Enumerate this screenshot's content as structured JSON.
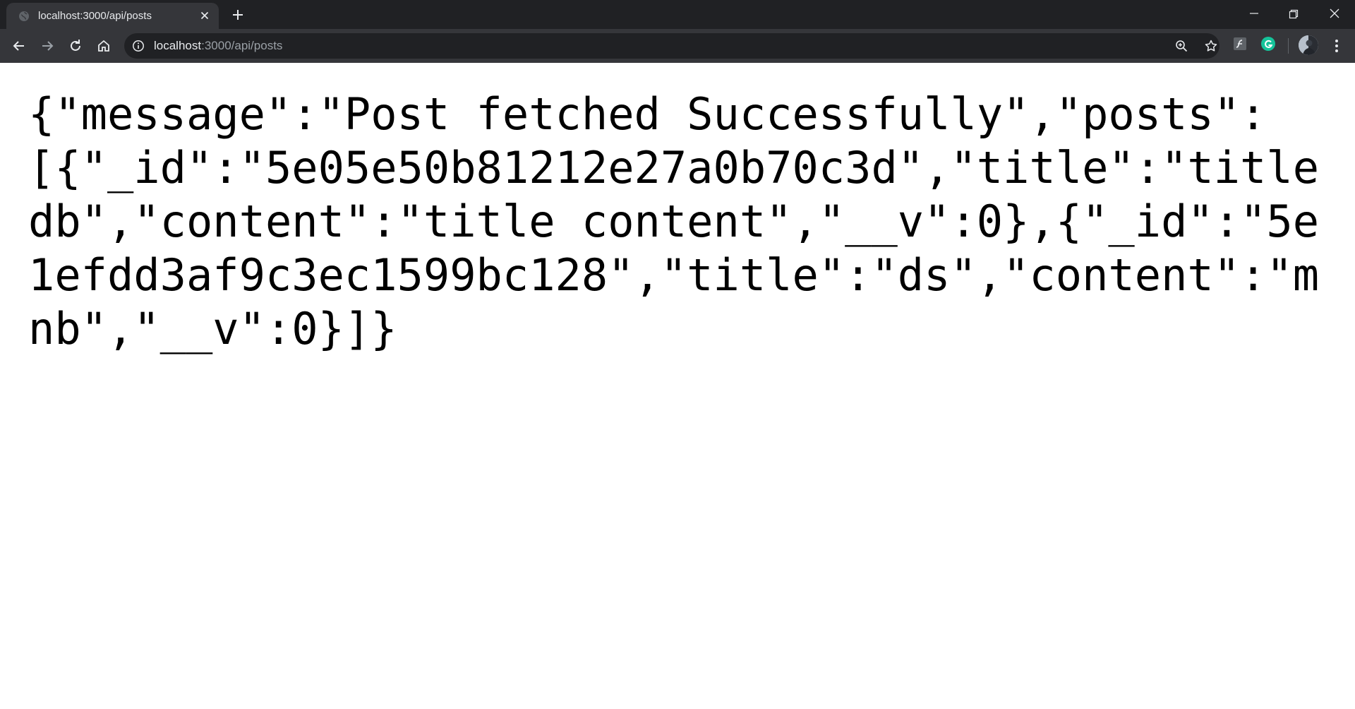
{
  "browser": {
    "tab": {
      "title": "localhost:3000/api/posts",
      "favicon": "globe-icon"
    },
    "address_bar": {
      "host": "localhost",
      "rest": ":3000/api/posts"
    },
    "icons": {
      "back": "arrow-left-icon",
      "forward": "arrow-right-icon",
      "reload": "reload-icon",
      "home": "home-icon",
      "site_info": "info-icon",
      "zoom": "zoom-icon",
      "bookmark": "star-icon",
      "extension_1": "flash-extension-icon",
      "extension_2": "grammarly-icon",
      "menu": "more-vert-icon"
    },
    "colors": {
      "tabstrip": "#202124",
      "toolbar": "#35363a",
      "grammarly": "#15c39a"
    }
  },
  "page": {
    "body_text": "{\"message\":\"Post fetched Successfully\",\"posts\":[{\"_id\":\"5e05e50b81212e27a0b70c3d\",\"title\":\"title db\",\"content\":\"title content\",\"__v\":0},{\"_id\":\"5e1efdd3af9c3ec1599bc128\",\"title\":\"ds\",\"content\":\"mnb\",\"__v\":0}]}"
  }
}
